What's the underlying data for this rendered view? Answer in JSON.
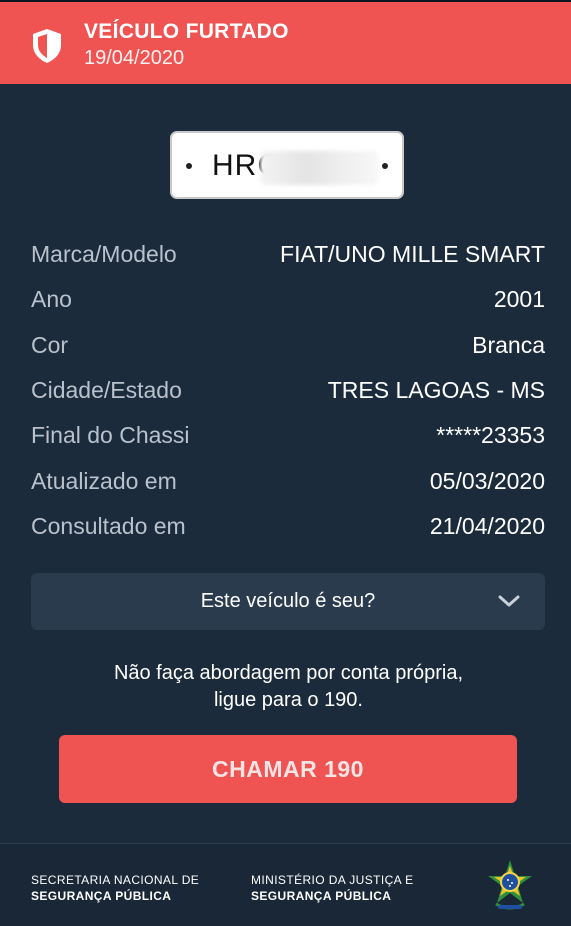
{
  "alert": {
    "title": "VEÍCULO FURTADO",
    "date": "19/04/2020",
    "icon": "shield-icon",
    "color": "#ef5453"
  },
  "plate": {
    "visible_text": "HRC"
  },
  "details": [
    {
      "label": "Marca/Modelo",
      "value": "FIAT/UNO MILLE SMART"
    },
    {
      "label": "Ano",
      "value": "2001"
    },
    {
      "label": "Cor",
      "value": "Branca"
    },
    {
      "label": "Cidade/Estado",
      "value": "TRES LAGOAS - MS"
    },
    {
      "label": "Final do Chassi",
      "value": "*****23353"
    },
    {
      "label": "Atualizado em",
      "value": "05/03/2020"
    },
    {
      "label": "Consultado em",
      "value": "21/04/2020"
    }
  ],
  "owner_question": {
    "label": "Este veículo é seu?",
    "icon": "chevron-down-icon"
  },
  "warning": {
    "line1": "Não faça abordagem por conta própria,",
    "line2": "ligue para o 190."
  },
  "call_button": {
    "label": "CHAMAR 190"
  },
  "footer": {
    "org1_line1": "SECRETARIA NACIONAL DE",
    "org1_line2": "SEGURANÇA PÚBLICA",
    "org2_line1": "MINISTÉRIO DA JUSTIÇA E",
    "org2_line2": "SEGURANÇA PÚBLICA",
    "emblem_icon": "brazil-coat-of-arms-icon"
  },
  "colors": {
    "background": "#1c2b3b",
    "accent": "#ef5453",
    "panel": "#2a3b4e"
  }
}
